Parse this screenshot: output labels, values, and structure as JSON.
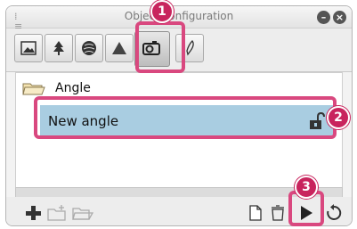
{
  "window": {
    "title": "Object configuration"
  },
  "list": {
    "folder": {
      "label": "Angle"
    },
    "item": {
      "label": "New angle"
    }
  },
  "callouts": [
    {
      "number": "1"
    },
    {
      "number": "2"
    },
    {
      "number": "3"
    }
  ],
  "colors": {
    "accent": "#d9487f",
    "badge": "#c8245d",
    "selection": "#a9cde1"
  },
  "icons": {
    "tabs": [
      "image-icon",
      "tree-icon",
      "sphere-icon",
      "terrain-icon",
      "camera-icon",
      "pen-icon"
    ],
    "bottom": [
      "add-icon",
      "new-folder-icon",
      "open-folder-icon",
      "document-icon",
      "delete-icon",
      "play-icon",
      "reset-icon"
    ]
  }
}
